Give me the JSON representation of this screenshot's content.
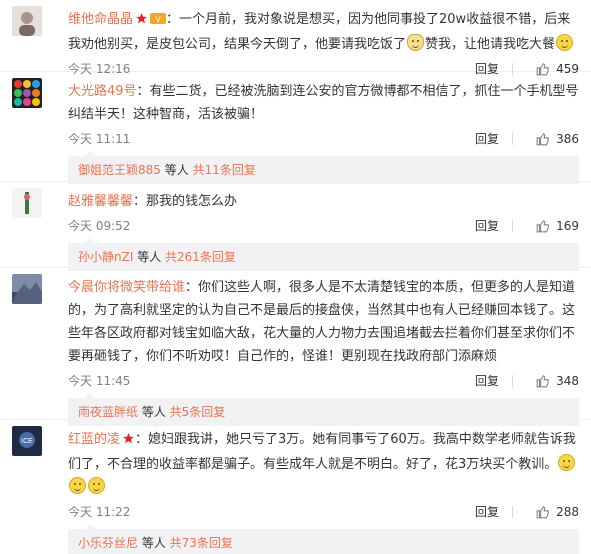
{
  "comments": [
    {
      "user": "维他命晶晶",
      "text_a": "：一个月前，我对象说是想买，因为他同事投了20w收益很不错，后来我劝他别买，是皮包公司，结果今天倒了，他要请我吃饭了",
      "text_b": "赞我，让他请我吃大餐",
      "time": "今天 12:16",
      "reply": "回复",
      "likes": "459",
      "avatar_color": "#c8c0bd"
    },
    {
      "user": "大光路49号",
      "text": "：有些二货，已经被洗脑到连公安的官方微博都不相信了，抓住一个手机型号纠结半天！这种智商，活该被骗！",
      "time": "今天 11:11",
      "reply": "回复",
      "likes": "386",
      "sub_name": "御姐范王颖885",
      "sub_mid": " 等人 ",
      "sub_count": "共11条回复"
    },
    {
      "user": "赵雅馨馨馨",
      "text": "：那我的钱怎么办",
      "time": "今天 09:52",
      "reply": "回复",
      "likes": "169",
      "sub_name": "孙小静nZI",
      "sub_mid": " 等人 ",
      "sub_count": "共261条回复"
    },
    {
      "user": "今晨你将微笑带给谁",
      "text": "：你们这些人啊，很多人是不太清楚钱宝的本质，但更多的人是知道的，为了高利就坚定的认为自己不是最后的接盘侠，当然其中也有人已经赚回本钱了。这些年各区政府都对钱宝如临大敌，花大量的人力物力去围追堵截去拦着你们甚至求你们不要再砸钱了，你们不听劝哎！自己作的，怪谁！更别现在找政府部门添麻烦",
      "time": "今天 11:45",
      "reply": "回复",
      "likes": "348",
      "sub_name": "雨夜蓝胖纸",
      "sub_mid": " 等人 ",
      "sub_count": "共5条回复"
    },
    {
      "user": "红蓝的凌",
      "text": "：媳妇跟我讲，她只亏了3万。她有同事亏了60万。我高中数学老师就告诉我们了，不合理的收益率都是骗子。有些成年人就是不明白。好了，花3万块买个教训。",
      "time": "今天 11:22",
      "reply": "回复",
      "likes": "288",
      "sub_name": "小乐芬丝尼",
      "sub_mid": " 等人 ",
      "sub_count": "共73条回复"
    }
  ],
  "colors": {
    "username": "#eb7350",
    "subbox": "#f2f2f5",
    "meta": "#808080"
  },
  "icons": [
    "star-icon",
    "vip-icon",
    "thumb-up-icon",
    "smile-emoji-icon",
    "cat-emoji-icon"
  ]
}
